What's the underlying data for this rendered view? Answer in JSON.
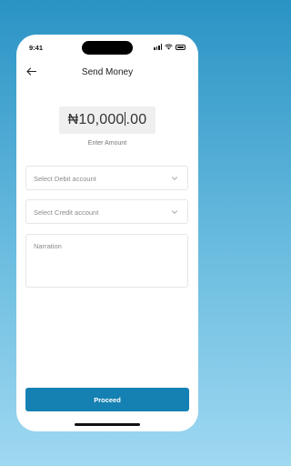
{
  "status_bar": {
    "time": "9:41"
  },
  "header": {
    "title": "Send Money",
    "back_icon": "arrow-left-icon"
  },
  "amount": {
    "currency": "₦",
    "value_before_cursor": "10,000",
    "value_after_cursor": ".00",
    "label": "Enter Amount"
  },
  "form": {
    "debit_placeholder": "Select Debit account",
    "credit_placeholder": "Select Credit account",
    "narration_placeholder": "Narration"
  },
  "actions": {
    "proceed_label": "Proceed"
  },
  "colors": {
    "primary": "#1581b3",
    "background_top": "#2a93c4",
    "background_bottom": "#9fd8f1"
  }
}
